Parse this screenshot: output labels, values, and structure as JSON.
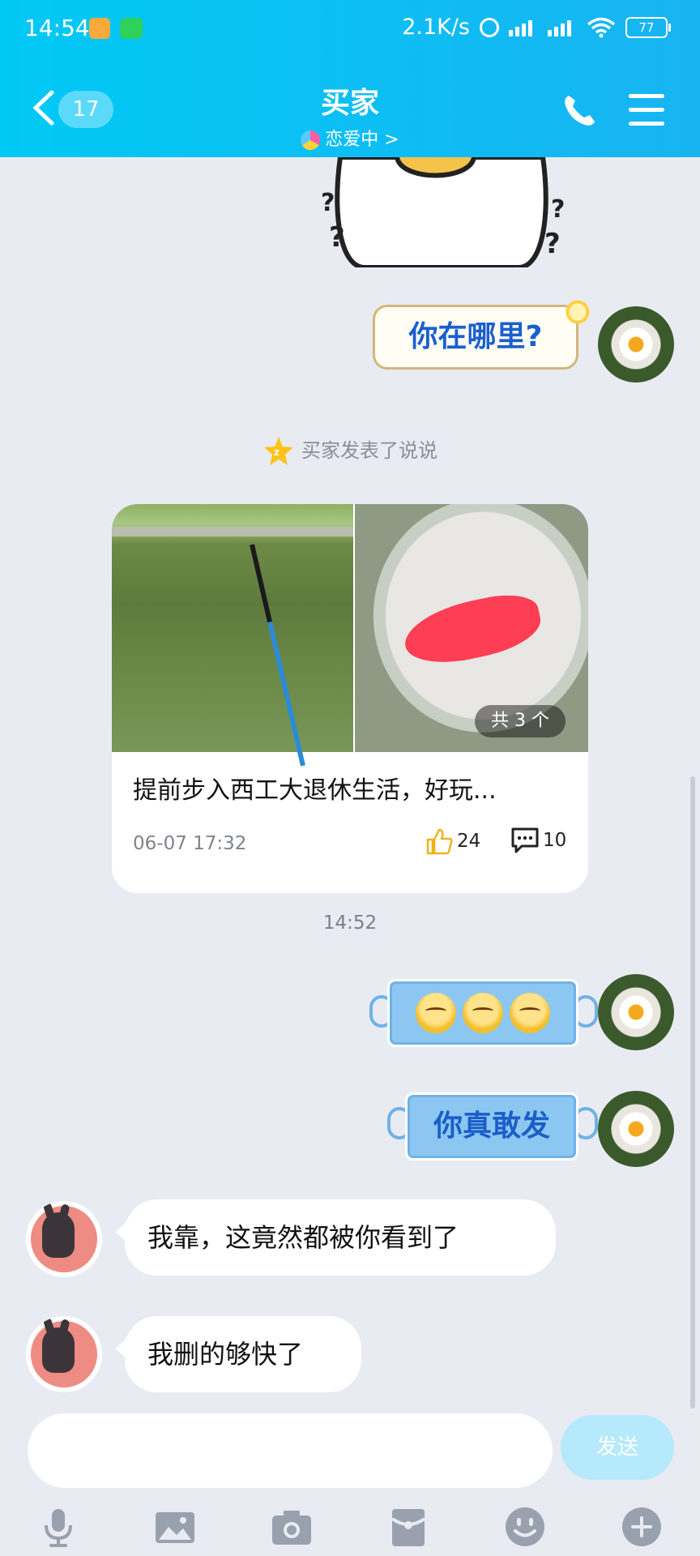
{
  "status_bar": {
    "time": "14:54",
    "net_speed": "2.1K/s",
    "battery": "77"
  },
  "header": {
    "back_count": "17",
    "title": "买家",
    "subtitle": "恋爱中 >"
  },
  "messages": {
    "self_bubble_1": "你在哪里?",
    "notice": "买家发表了说说",
    "post": {
      "image_count_label": "共 3 个",
      "title": "提前步入西工大退休生活，好玩...",
      "date": "06-07 17:32",
      "likes": "24",
      "comments": "10"
    },
    "timestamp": "14:52",
    "self_bubble_3": "你真敢发",
    "other_bubble_1": "我靠，这竟然都被你看到了",
    "other_bubble_2": "我删的够快了"
  },
  "input": {
    "send_label": "发送"
  },
  "colors": {
    "header_start": "#00c9f5",
    "header_end": "#18b4f2",
    "background": "#e9ebf2",
    "send_button": "#b5e9fb"
  }
}
